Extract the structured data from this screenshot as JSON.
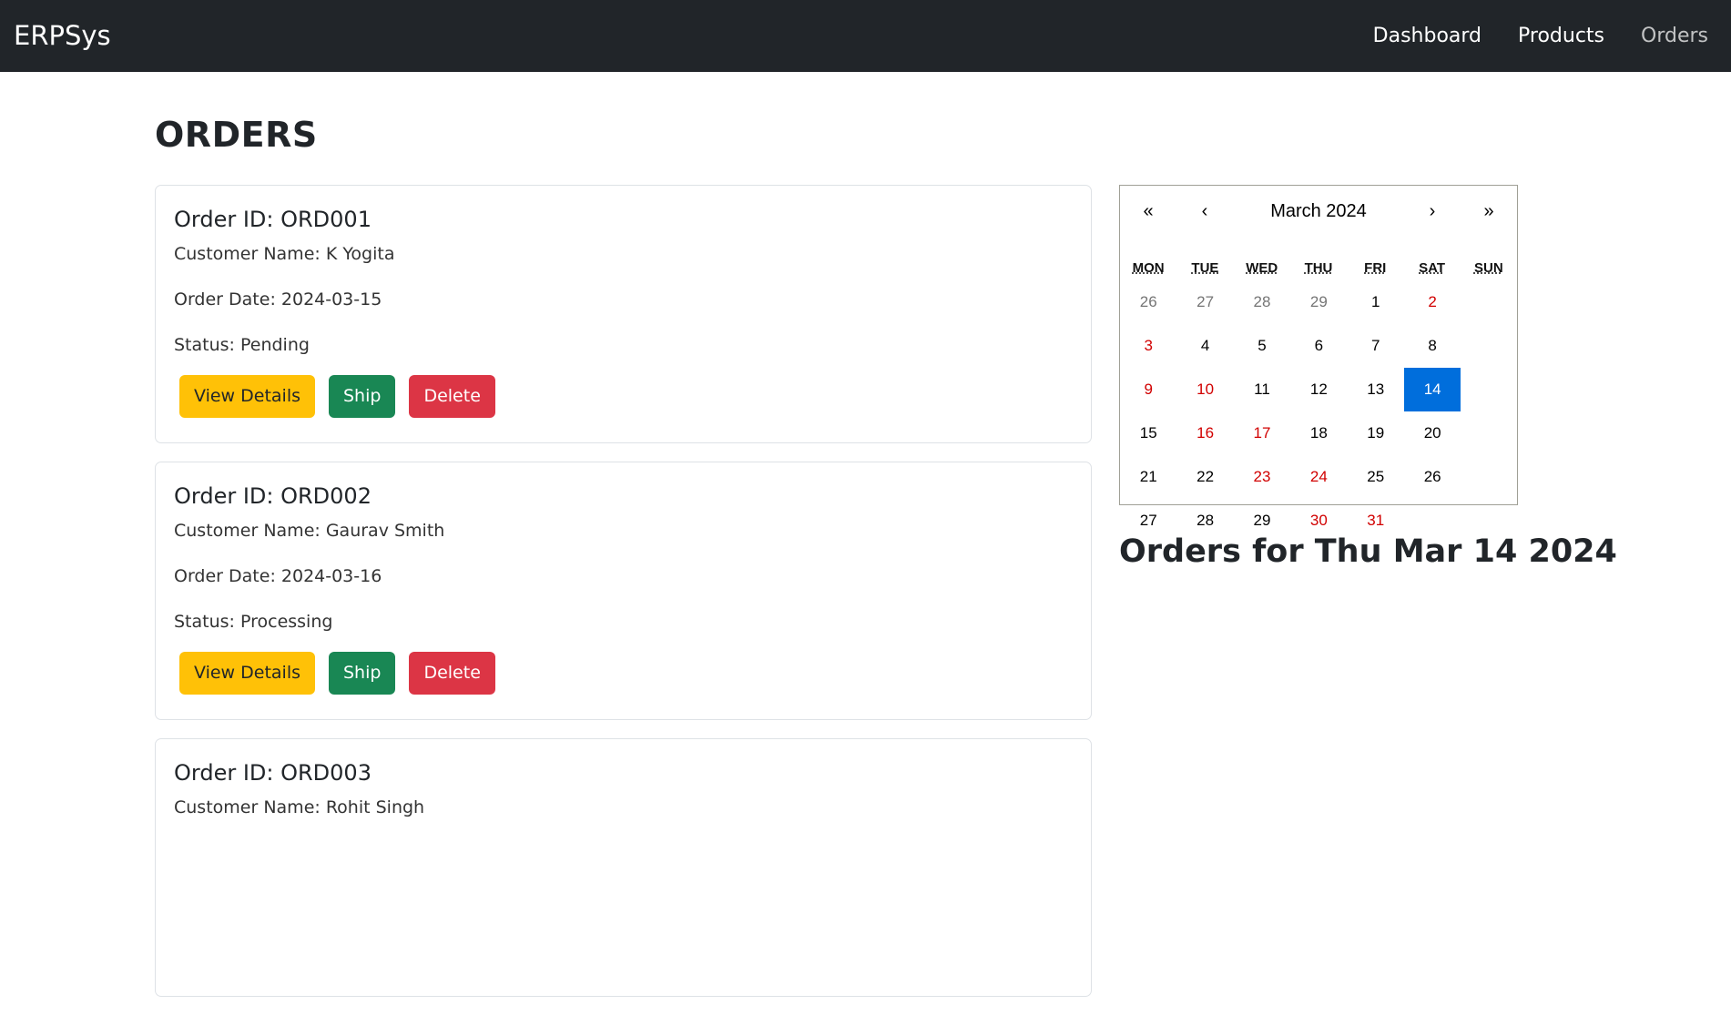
{
  "navbar": {
    "brand": "ERPSys",
    "links": [
      {
        "label": "Dashboard"
      },
      {
        "label": "Products"
      },
      {
        "label": "Orders"
      }
    ]
  },
  "page": {
    "title": "ORDERS"
  },
  "orders": [
    {
      "id_line": "Order ID: ORD001",
      "customer": "Customer Name: K Yogita",
      "date": "Order Date: 2024-03-15",
      "status": "Status: Pending"
    },
    {
      "id_line": "Order ID: ORD002",
      "customer": "Customer Name: Gaurav Smith",
      "date": "Order Date: 2024-03-16",
      "status": "Status: Processing"
    },
    {
      "id_line": "Order ID: ORD003",
      "customer": "Customer Name: Rohit Singh",
      "date": "",
      "status": ""
    }
  ],
  "buttons": {
    "view": "View Details",
    "ship": "Ship",
    "delete": "Delete"
  },
  "calendar": {
    "nav": {
      "prev_year": "«",
      "prev_month": "‹",
      "next_month": "›",
      "next_year": "»"
    },
    "month_label": "March 2024",
    "weekdays": [
      "MON",
      "TUE",
      "WED",
      "THU",
      "FRI",
      "SAT",
      "SUN"
    ],
    "weeks": [
      [
        "26",
        "27",
        "28",
        "29",
        "1",
        "2",
        "3"
      ],
      [
        "4",
        "5",
        "6",
        "7",
        "8",
        "9",
        "10"
      ],
      [
        "11",
        "12",
        "13",
        "14",
        "15",
        "16",
        "17"
      ],
      [
        "18",
        "19",
        "20",
        "21",
        "22",
        "23",
        "24"
      ],
      [
        "25",
        "26",
        "27",
        "28",
        "29",
        "30",
        "31"
      ]
    ],
    "selected_day": "14",
    "colors": {
      "selected_bg": "#006edc",
      "weekend": "#d10000",
      "neighbor": "#757575"
    }
  },
  "orders_for_heading": "Orders for Thu Mar 14 2024",
  "colors": {
    "navbar_bg": "#212529",
    "btn_warning": "#ffc107",
    "btn_success": "#198754",
    "btn_danger": "#dc3545"
  }
}
